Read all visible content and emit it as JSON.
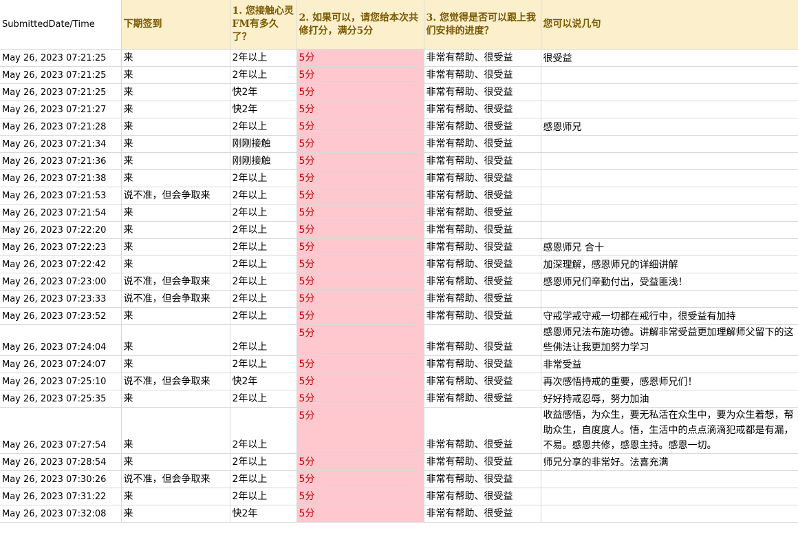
{
  "headers": [
    "SubmittedDate/Time",
    "下期签到",
    "1. 您接触心灵FM有多久了？",
    "2. 如果可以，请您给本次共修打分，满分5分",
    "3. 您觉得是否可以跟上我们安排的进度？",
    "您可以说几句"
  ],
  "rows": [
    [
      "May 26, 2023 07:21:25",
      "来",
      "2年以上",
      "5分",
      "非常有帮助、很受益",
      "很受益"
    ],
    [
      "May 26, 2023 07:21:25",
      "来",
      "2年以上",
      "5分",
      "非常有帮助、很受益",
      ""
    ],
    [
      "May 26, 2023 07:21:25",
      "来",
      "快2年",
      "5分",
      "非常有帮助、很受益",
      ""
    ],
    [
      "May 26, 2023 07:21:27",
      "来",
      "快2年",
      "5分",
      "非常有帮助、很受益",
      ""
    ],
    [
      "May 26, 2023 07:21:28",
      "来",
      "2年以上",
      "5分",
      "非常有帮助、很受益",
      "感恩师兄"
    ],
    [
      "May 26, 2023 07:21:34",
      "来",
      "刚刚接触",
      "5分",
      "非常有帮助、很受益",
      ""
    ],
    [
      "May 26, 2023 07:21:36",
      "来",
      "刚刚接触",
      "5分",
      "非常有帮助、很受益",
      ""
    ],
    [
      "May 26, 2023 07:21:38",
      "来",
      "2年以上",
      "5分",
      "非常有帮助、很受益",
      ""
    ],
    [
      "May 26, 2023 07:21:53",
      "说不准，但会争取来",
      "2年以上",
      "5分",
      "非常有帮助、很受益",
      ""
    ],
    [
      "May 26, 2023 07:21:54",
      "来",
      "2年以上",
      "5分",
      "非常有帮助、很受益",
      ""
    ],
    [
      "May 26, 2023 07:22:20",
      "来",
      "2年以上",
      "5分",
      "非常有帮助、很受益",
      ""
    ],
    [
      "May 26, 2023 07:22:23",
      "来",
      "2年以上",
      "5分",
      "非常有帮助、很受益",
      "感恩师兄 合十"
    ],
    [
      "May 26, 2023 07:22:42",
      "来",
      "2年以上",
      "5分",
      "非常有帮助、很受益",
      "加深理解，感恩师兄的详细讲解"
    ],
    [
      "May 26, 2023 07:23:00",
      "说不准，但会争取来",
      "2年以上",
      "5分",
      "非常有帮助、很受益",
      "感恩师兄们辛勤付出，受益匪浅！"
    ],
    [
      "May 26, 2023 07:23:33",
      "说不准，但会争取来",
      "2年以上",
      "5分",
      "非常有帮助、很受益",
      ""
    ],
    [
      "May 26, 2023 07:23:52",
      "来",
      "2年以上",
      "5分",
      "非常有帮助、很受益",
      "守戒学戒守戒一切都在戒行中，很受益有加持"
    ],
    [
      "May 26, 2023 07:24:04",
      "来",
      "2年以上",
      "5分",
      "非常有帮助、很受益",
      "感恩师兄法布施功德。讲解非常受益更加理解师父留下的这些佛法让我更加努力学习"
    ],
    [
      "May 26, 2023 07:24:07",
      "来",
      "2年以上",
      "5分",
      "非常有帮助、很受益",
      "非常受益"
    ],
    [
      "May 26, 2023 07:25:10",
      "说不准，但会争取来",
      "快2年",
      "5分",
      "非常有帮助、很受益",
      "再次感悟持戒的重要，感恩师兄们！"
    ],
    [
      "May 26, 2023 07:25:35",
      "来",
      "2年以上",
      "5分",
      "非常有帮助、很受益",
      "好好持戒忍辱，努力加油"
    ],
    [
      "May 26, 2023 07:27:54",
      "来",
      "2年以上",
      "5分",
      "非常有帮助、很受益",
      "收益感悟，为众生，要无私活在众生中，要为众生着想，帮助众生，自度度人。悟，生活中的点点滴滴犯戒都是有漏，不易。感恩共修，感恩主持。感恩一切。"
    ],
    [
      "May 26, 2023 07:28:54",
      "来",
      "2年以上",
      "5分",
      "非常有帮助、很受益",
      "师兄分享的非常好。法喜充满"
    ],
    [
      "May 26, 2023 07:30:26",
      "说不准，但会争取来",
      "2年以上",
      "5分",
      "非常有帮助、很受益",
      ""
    ],
    [
      "May 26, 2023 07:31:22",
      "来",
      "2年以上",
      "5分",
      "非常有帮助、很受益",
      ""
    ],
    [
      "May 26, 2023 07:32:08",
      "来",
      "快2年",
      "5分",
      "非常有帮助、很受益",
      ""
    ]
  ]
}
